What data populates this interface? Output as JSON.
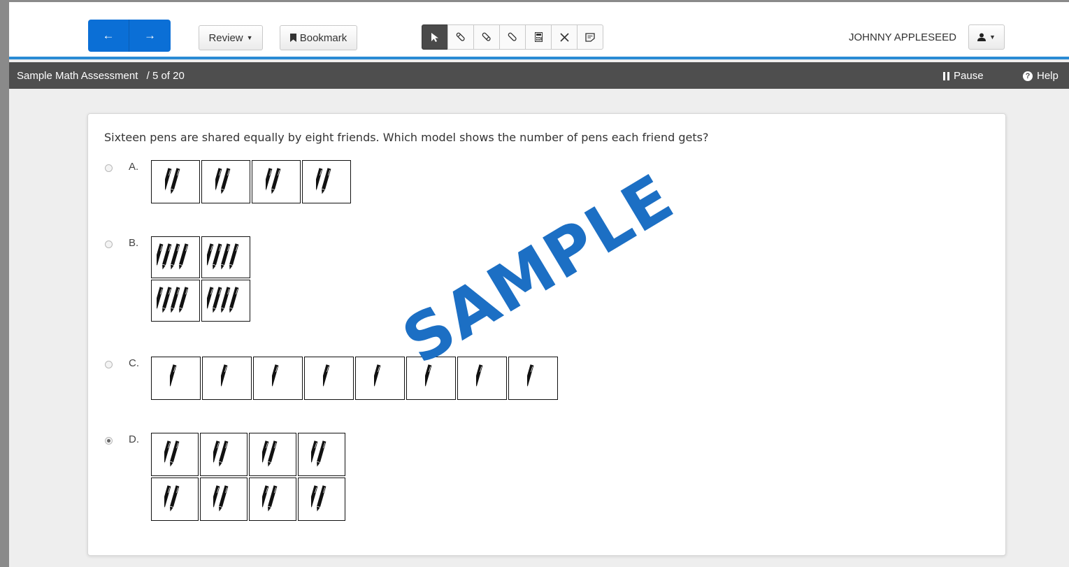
{
  "toolbar": {
    "back_icon": "←",
    "forward_icon": "→",
    "review_label": "Review",
    "bookmark_label": "Bookmark",
    "tools": [
      "pointer-tool",
      "highlighter-tool",
      "eraser-tool",
      "line-reader-tool",
      "calculator-tool",
      "strikethrough-tool",
      "notepad-tool"
    ],
    "user_name": "JOHNNY APPLESEED"
  },
  "infobar": {
    "assessment_title": "Sample Math Assessment",
    "separator": "/",
    "progress": "5 of 20",
    "pause_label": "Pause",
    "help_label": "Help"
  },
  "question": {
    "text": "Sixteen pens are shared equally by eight friends. Which model shows the number of pens each friend gets?",
    "selected": "D",
    "options": [
      {
        "letter": "A.",
        "pens_per_box": 2,
        "box_count": 4
      },
      {
        "letter": "B.",
        "pens_per_box": 4,
        "box_count": 4
      },
      {
        "letter": "C.",
        "pens_per_box": 1,
        "box_count": 8
      },
      {
        "letter": "D.",
        "pens_per_box": 2,
        "box_count": 8
      }
    ]
  },
  "watermark": "SAMPLE",
  "colors": {
    "nav_blue": "#0b6fd6",
    "accent_line": "#2a8bd4",
    "info_bar": "#4e4e4e",
    "watermark": "#1c6fc4"
  }
}
